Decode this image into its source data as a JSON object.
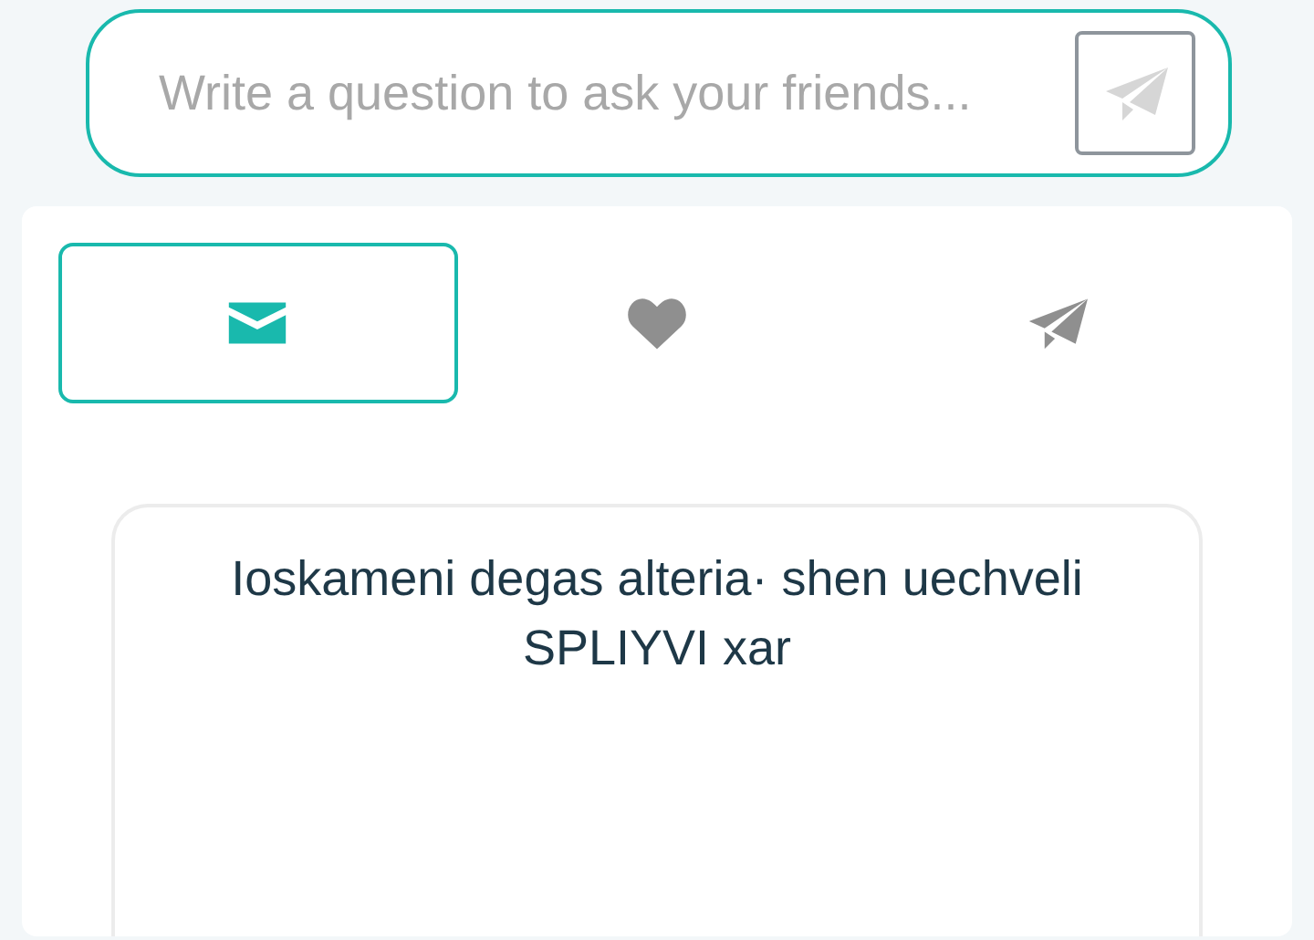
{
  "ask": {
    "placeholder": "Write a question to ask your friends..."
  },
  "tabs": [
    {
      "kind": "inbox",
      "selected": true
    },
    {
      "kind": "liked",
      "selected": false
    },
    {
      "kind": "sent",
      "selected": false
    }
  ],
  "question": {
    "text": "Ioskameni degas alteria· shen uechveli SPLIYVI xar"
  }
}
